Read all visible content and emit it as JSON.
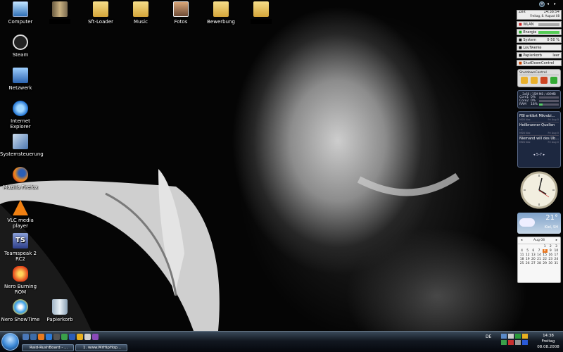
{
  "icons": [
    {
      "label": "Computer"
    },
    {
      "label": "Steam"
    },
    {
      "label": "Netzwerk"
    },
    {
      "label": "Internet Explorer"
    },
    {
      "label": "Systemsteuerung"
    },
    {
      "label": "Mozilla Firefox"
    },
    {
      "label": "VLC media player"
    },
    {
      "label": "Teamspeak 2 RC2"
    },
    {
      "label": "Nero Burning ROM"
    },
    {
      "label": "Nero ShowTime"
    },
    {
      "label": "Papierkorb"
    },
    {
      "label": "Sft-Loader"
    },
    {
      "label": "Music"
    },
    {
      "label": "Fotos"
    },
    {
      "label": "Bewerbung"
    }
  ],
  "teamspeak_glyph": "TS",
  "gadgets": {
    "zeit_label": "Zeit",
    "zeit_value": "14:38:54",
    "zeit_date": "Freitag, 8. August 08",
    "wlan_label": "WLAN",
    "energie_label": "Energie",
    "system_label": "System",
    "system_value": "0-50 %",
    "lautstaerke_label": "LouTwerke",
    "papierkorb_label": "Papierkorb",
    "papierkorb_value": "leer",
    "shutdown_label": "ShutDownControl",
    "shutdown_panel_title": "ShutdownControl",
    "cpu_title": "2x66 / 1SM MB / 409MB",
    "cpu_rows": [
      {
        "label": "Core1",
        "value": "0%"
      },
      {
        "label": "Core2",
        "value": "0%"
      },
      {
        "label": "RAM",
        "value": "18%"
      }
    ],
    "news": [
      {
        "title": "FBI erklärt Mikrobi...",
        "source": "MSN Nac",
        "date": "Fri Aug 0"
      },
      {
        "title": "Heilbrunner-Quellen ...",
        "source": "MSN Nac",
        "date": "Fri Aug 0"
      },
      {
        "title": "Niemand will des Ub...",
        "source": "MSN Nac",
        "date": "Fri Aug 0"
      }
    ],
    "news_pager": "5-7",
    "weather_temp": "21°",
    "weather_place": "Kiel, SH",
    "cal_month": "Aug 08",
    "cal_days": [
      "",
      "",
      "",
      "",
      "1",
      "2",
      "3",
      "4",
      "5",
      "6",
      "7",
      "8",
      "9",
      "10",
      "11",
      "12",
      "13",
      "14",
      "15",
      "16",
      "17",
      "18",
      "19",
      "20",
      "21",
      "22",
      "23",
      "24",
      "25",
      "26",
      "27",
      "28",
      "29",
      "30",
      "31"
    ],
    "cal_today": "8"
  },
  "taskbar": {
    "tasks": [
      {
        "label": "Raid-RushBoard - ..."
      },
      {
        "label": "1. www.MrHipHop..."
      }
    ],
    "lang": "DE",
    "time": "14:38",
    "day": "Freitag",
    "date": "08.08.2008"
  },
  "colors": {
    "start_orb": "#3a87d6",
    "accent": "#6e86a0"
  }
}
